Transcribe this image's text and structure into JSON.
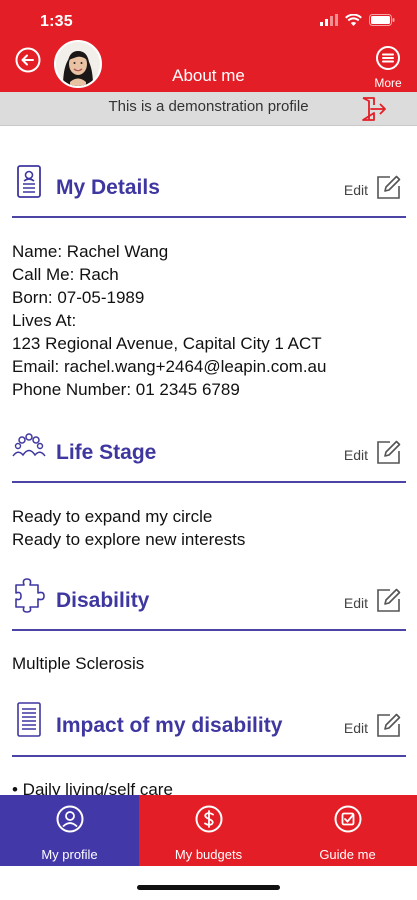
{
  "status_bar": {
    "time": "1:35"
  },
  "header": {
    "title": "About me",
    "more_label": "More"
  },
  "banner": {
    "text": "This is a demonstration profile"
  },
  "sections": {
    "details": {
      "title": "My Details",
      "edit_label": "Edit",
      "lines": [
        "Name: Rachel Wang",
        "Call Me: Rach",
        "Born: 07-05-1989",
        "Lives At:",
        "123 Regional Avenue, Capital City 1 ACT",
        "Email: rachel.wang+2464@leapin.com.au",
        "Phone Number: 01 2345 6789"
      ]
    },
    "life_stage": {
      "title": "Life Stage",
      "edit_label": "Edit",
      "lines": [
        "Ready to expand my circle",
        "Ready to explore new interests"
      ]
    },
    "disability": {
      "title": "Disability",
      "edit_label": "Edit",
      "lines": [
        "Multiple Sclerosis"
      ]
    },
    "impact": {
      "title": "Impact of my disability",
      "edit_label": "Edit",
      "lines": [
        "• Daily living/self care"
      ]
    }
  },
  "tabs": [
    {
      "label": "My profile",
      "icon": "user-circle-icon",
      "active": true
    },
    {
      "label": "My budgets",
      "icon": "dollar-circle-icon",
      "active": false
    },
    {
      "label": "Guide me",
      "icon": "checkbox-circle-icon",
      "active": false
    }
  ],
  "colors": {
    "brand_red": "#e41e26",
    "accent_purple": "#3f37a0",
    "active_tab": "#4338a8"
  }
}
